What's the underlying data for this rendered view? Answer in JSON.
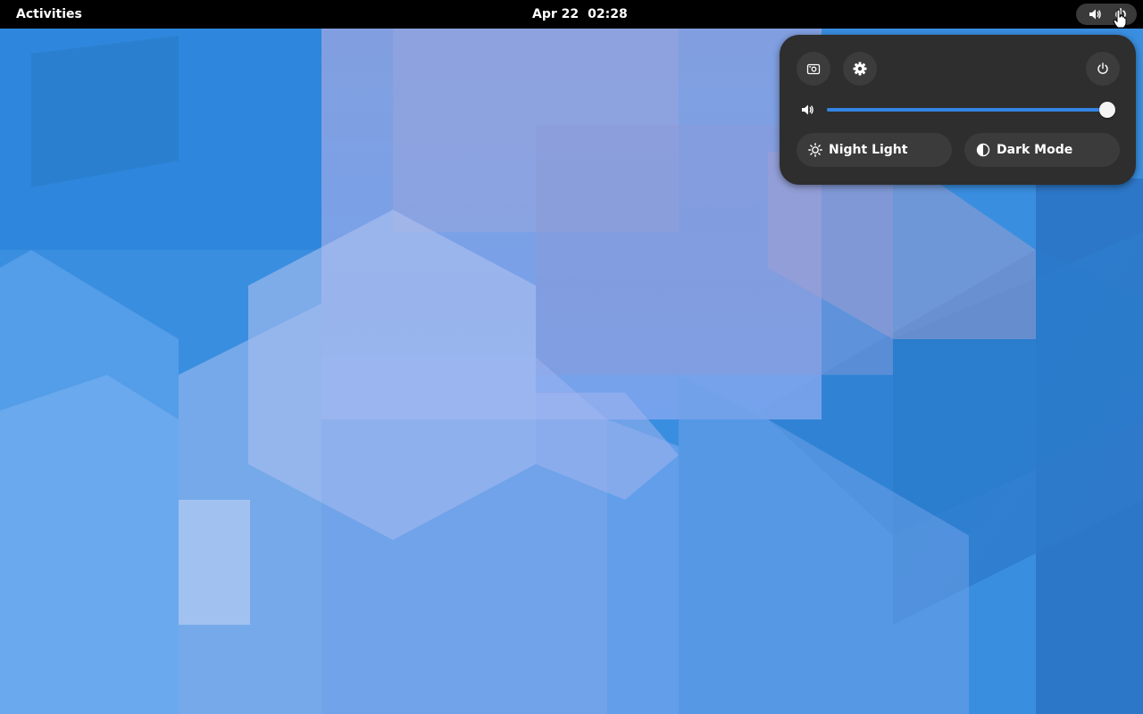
{
  "topbar": {
    "activities_label": "Activities",
    "date": "Apr 22",
    "time": "02:28",
    "indicators": [
      "volume-icon",
      "power-icon"
    ]
  },
  "quick_settings": {
    "buttons": [
      "screenshot-icon",
      "gear-icon",
      "power-icon"
    ],
    "volume": {
      "icon": "volume-icon",
      "level": 1.0
    },
    "toggles": [
      {
        "label": "Night Light",
        "icon": "sun-icon",
        "active": false
      },
      {
        "label": "Dark Mode",
        "icon": "contrast-icon",
        "active": false
      }
    ]
  },
  "colors": {
    "topbar": "#000000",
    "menu_bg": "#2e2e2e",
    "button_bg": "#3c3c3c",
    "accent": "#3584e4"
  }
}
